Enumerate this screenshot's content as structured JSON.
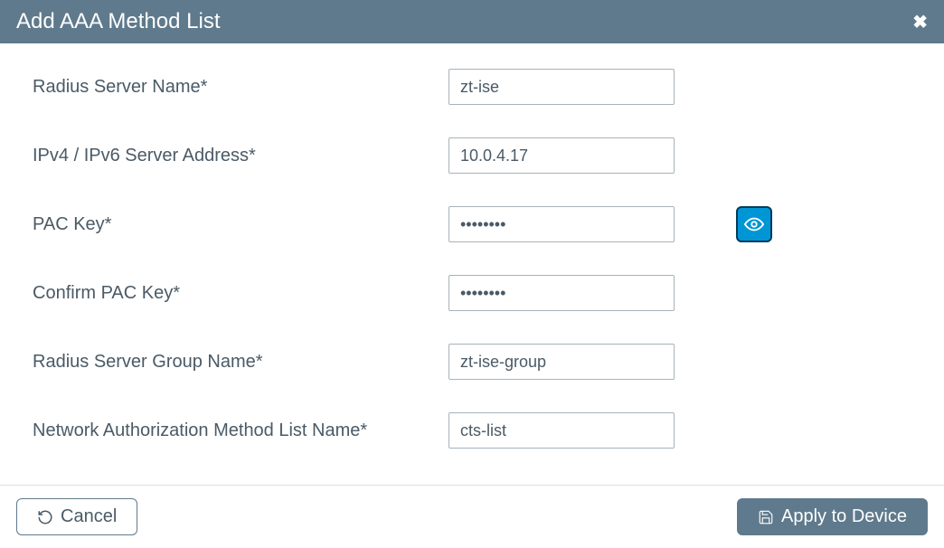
{
  "header": {
    "title": "Add AAA Method List"
  },
  "fields": {
    "radius_server_name": {
      "label": "Radius Server Name*",
      "value": "zt-ise"
    },
    "server_address": {
      "label": "IPv4 / IPv6 Server Address*",
      "value": "10.0.4.17"
    },
    "pac_key": {
      "label": "PAC Key*",
      "value": "••••••••"
    },
    "confirm_pac_key": {
      "label": "Confirm PAC Key*",
      "value": "••••••••"
    },
    "group_name": {
      "label": "Radius Server Group Name*",
      "value": "zt-ise-group"
    },
    "method_list_name": {
      "label": "Network Authorization Method List Name*",
      "value": "cts-list"
    }
  },
  "footer": {
    "cancel_label": "Cancel",
    "apply_label": "Apply to Device"
  }
}
